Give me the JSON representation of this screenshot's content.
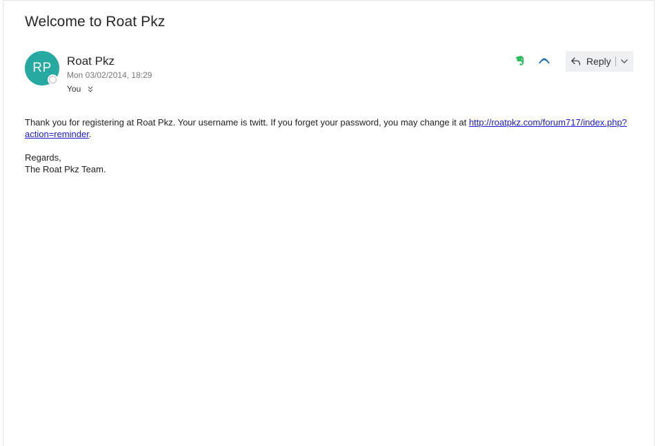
{
  "message": {
    "subject": "Welcome to Roat Pkz",
    "sender": {
      "initials": "RP",
      "name": "Roat Pkz",
      "avatar_color": "#25a9a0"
    },
    "date": "Mon 03/02/2014, 18:29",
    "to": "You",
    "body": {
      "intro_text": "Thank you for registering at Roat Pkz. Your username is twitt. If you forget your password, you may change it at ",
      "link_text": "http://roatpkz.com/forum717/index.php?action=reminder",
      "after_link": ".",
      "regards": "Regards,",
      "signature": "The Roat Pkz Team."
    }
  },
  "toolbar": {
    "evernote_icon": "evernote-icon",
    "addin_icon": "addin-icon",
    "reply_label": "Reply",
    "reply_icon": "reply-arrow-icon",
    "more_icon": "chevron-down-icon"
  },
  "colors": {
    "evernote_green": "#2dbe60",
    "addin_blue": "#1f6fb2",
    "link_blue": "#1a1ad6"
  }
}
